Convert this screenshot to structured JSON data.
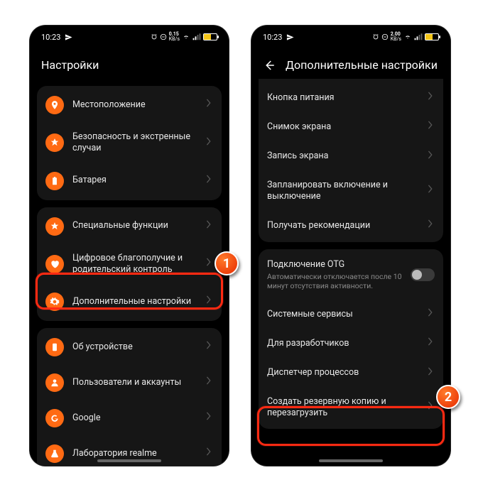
{
  "status": {
    "time": "10:23",
    "net_speed_left": "0.15",
    "net_speed_right": "2.00",
    "net_unit": "KB/s"
  },
  "left": {
    "title": "Настройки",
    "g1": [
      {
        "label": "Местоположение"
      },
      {
        "label": "Безопасность и экстренные случаи"
      },
      {
        "label": "Батарея"
      }
    ],
    "g2": [
      {
        "label": "Специальные функции"
      },
      {
        "label": "Цифровое благополучие и родительский контроль"
      },
      {
        "label": "Дополнительные настройки"
      }
    ],
    "g3": [
      {
        "label": "Об устройстве"
      },
      {
        "label": "Пользователи и аккаунты"
      },
      {
        "label": "Google"
      },
      {
        "label": "Лаборатория realme"
      }
    ]
  },
  "right": {
    "title": "Дополнительные настройки",
    "g1": [
      {
        "label": "Кнопка питания"
      },
      {
        "label": "Снимок экрана"
      },
      {
        "label": "Запись экрана"
      },
      {
        "label": "Запланировать включение и выключение"
      },
      {
        "label": "Получать рекомендации"
      }
    ],
    "g2_title": "Подключение OTG",
    "g2_sub": "Автоматически отключается после 10 минут отсутствия активности.",
    "g2_rest": [
      {
        "label": "Системные сервисы"
      },
      {
        "label": "Для разработчиков"
      },
      {
        "label": "Диспетчер процессов"
      },
      {
        "label": "Создать резервную копию и перезагрузить"
      }
    ]
  },
  "steps": {
    "one": "1",
    "two": "2"
  }
}
